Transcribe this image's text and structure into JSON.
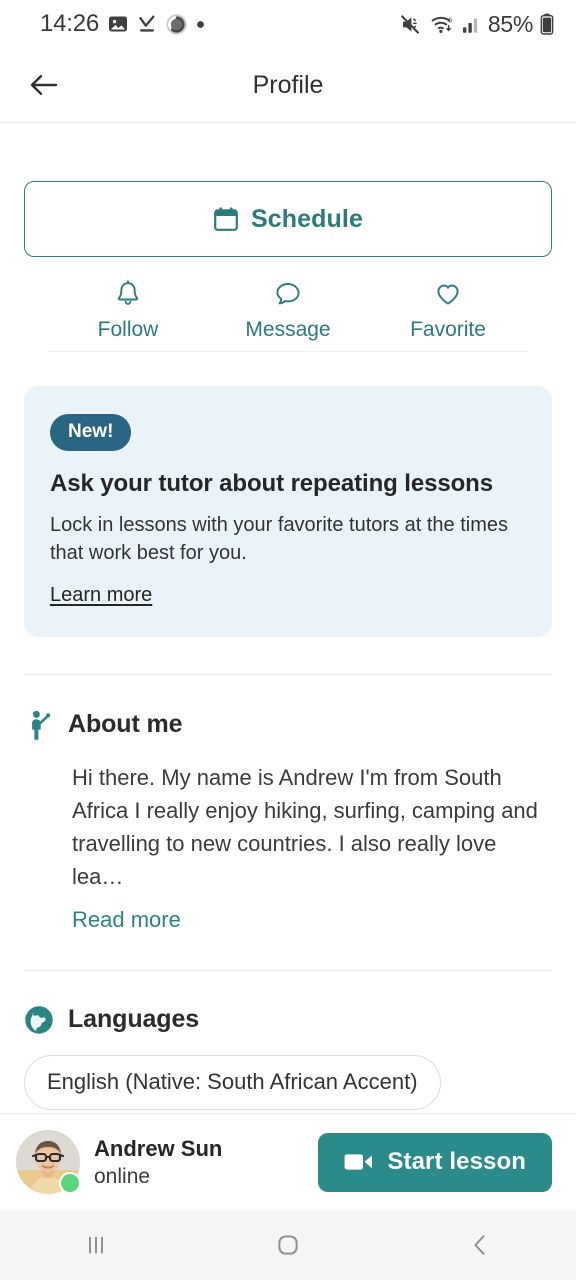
{
  "status_bar": {
    "time": "14:26",
    "battery": "85%",
    "left_icons": [
      "photo-icon",
      "download-done-icon",
      "progress-circle-icon",
      "dot-icon"
    ],
    "right_icons": [
      "mute-icon",
      "wifi-icon",
      "cellular-signal-icon",
      "battery-icon"
    ]
  },
  "app_bar": {
    "title": "Profile",
    "back_icon": "arrow-left-icon"
  },
  "schedule": {
    "label": "Schedule",
    "icon": "calendar-icon"
  },
  "actions": [
    {
      "label": "Follow",
      "icon": "bell-icon"
    },
    {
      "label": "Message",
      "icon": "chat-bubble-icon"
    },
    {
      "label": "Favorite",
      "icon": "heart-icon"
    }
  ],
  "promo": {
    "badge": "New!",
    "title": "Ask your tutor about repeating lessons",
    "body": "Lock in lessons with your favorite tutors at the times that work best for you.",
    "link": "Learn more"
  },
  "about": {
    "title": "About me",
    "icon": "person-waving-icon",
    "text": "Hi there. My name is Andrew I'm from South Africa I really enjoy hiking, surfing, camping and travelling to new countries. I also really love lea…",
    "read_more": "Read more"
  },
  "languages": {
    "title": "Languages",
    "icon": "globe-icon",
    "items": [
      "English (Native: South African Accent)"
    ]
  },
  "bottom_bar": {
    "name": "Andrew Sun",
    "status": "online",
    "avatar": "tutor-avatar",
    "start_label": "Start lesson",
    "start_icon": "video-camera-icon"
  },
  "nav_bar": {
    "recents": "recent-apps-icon",
    "home": "home-icon",
    "back": "back-chevron-icon"
  },
  "colors": {
    "teal": "#2a8484",
    "teal_dark": "#2a7b7b",
    "badge_blue": "#2b6584",
    "card_bg": "#eaf3f8",
    "online_green": "#5ad67d",
    "start_btn": "#2b8a8a"
  }
}
